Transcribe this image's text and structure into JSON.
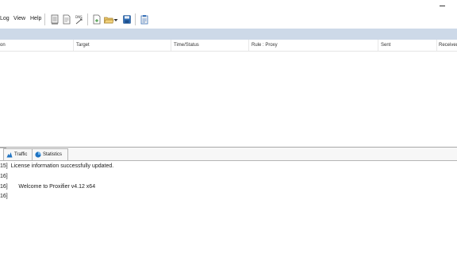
{
  "menu": {
    "log": "Log",
    "view": "View",
    "help": "Help"
  },
  "toolbar": {
    "icons": [
      "profile-icon",
      "log-file-icon",
      "dns-icon",
      "new-profile-icon",
      "open-profile-icon",
      "open-dropdown-icon",
      "save-icon",
      "clipboard-icon"
    ]
  },
  "connections": {
    "columns": [
      "on",
      "Target",
      "Time/Status",
      "Rule : Proxy",
      "Sent",
      "Received"
    ]
  },
  "tabs": [
    {
      "label": "",
      "icon": "connections-icon",
      "active": true
    },
    {
      "label": "Traffic",
      "icon": "traffic-icon",
      "active": false
    },
    {
      "label": "Statistics",
      "icon": "statistics-icon",
      "active": false
    }
  ],
  "log": [
    "15]  License information successfully updated.",
    "16]",
    "16]       Welcome to Proxifier v4.12 x64",
    "16]"
  ],
  "colors": {
    "band": "#cdd9e8",
    "accent": "#1f73c2"
  }
}
